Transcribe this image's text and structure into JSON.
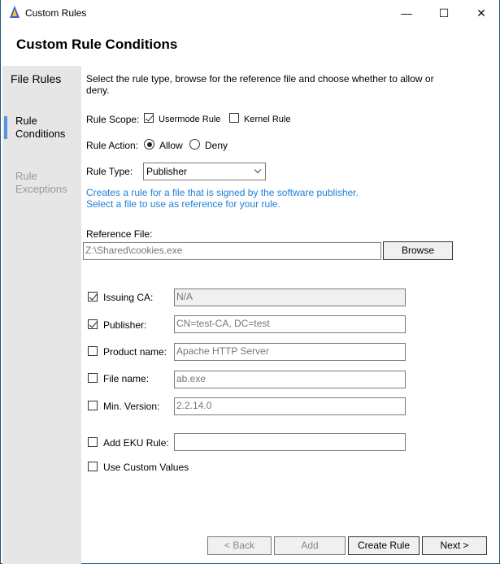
{
  "window": {
    "title": "Custom Rules",
    "minimize": "—",
    "maximize": "☐",
    "close": "✕"
  },
  "header": {
    "title": "Custom Rule Conditions"
  },
  "sidebar": {
    "items": [
      {
        "label": "File Rules",
        "state": "normal"
      },
      {
        "label": "Rule Conditions",
        "state": "active"
      },
      {
        "label": "Rule Exceptions",
        "state": "disabled"
      }
    ]
  },
  "main": {
    "description": "Select the rule type, browse for the reference file and choose whether to allow or deny.",
    "rule_scope": {
      "label": "Rule Scope:",
      "usermode": {
        "label": "Usermode Rule",
        "checked": true
      },
      "kernel": {
        "label": "Kernel Rule",
        "checked": false
      }
    },
    "rule_action": {
      "label": "Rule Action:",
      "allow": {
        "label": "Allow",
        "selected": true
      },
      "deny": {
        "label": "Deny",
        "selected": false
      }
    },
    "rule_type": {
      "label": "Rule Type:",
      "value": "Publisher"
    },
    "hint": [
      "Creates a rule for a file that is signed by the software publisher.",
      "Select a file to use as reference for your rule."
    ],
    "reference_file": {
      "label": "Reference File:",
      "value": "Z:\\Shared\\cookies.exe",
      "browse": "Browse"
    },
    "fields": [
      {
        "label": "Issuing CA:",
        "value": "N/A",
        "checked": true,
        "disabled": true
      },
      {
        "label": "Publisher:",
        "value": "CN=test-CA, DC=test",
        "checked": true
      },
      {
        "label": "Product name:",
        "value": "Apache HTTP Server",
        "checked": false
      },
      {
        "label": "File name:",
        "value": "ab.exe",
        "checked": false
      },
      {
        "label": "Min. Version:",
        "value": "2.2.14.0",
        "checked": false
      },
      {
        "label": "Add EKU Rule:",
        "value": "",
        "checked": false
      }
    ],
    "custom_values": {
      "label": "Use Custom Values",
      "checked": false
    }
  },
  "footer": {
    "back": "< Back",
    "add": "Add",
    "create": "Create Rule",
    "next": "Next >"
  },
  "colors": {
    "accent": "#5b8fe0",
    "hint": "#1e7fd8",
    "sidebar": "#e6e6e6",
    "border": "#1e5a7a"
  }
}
